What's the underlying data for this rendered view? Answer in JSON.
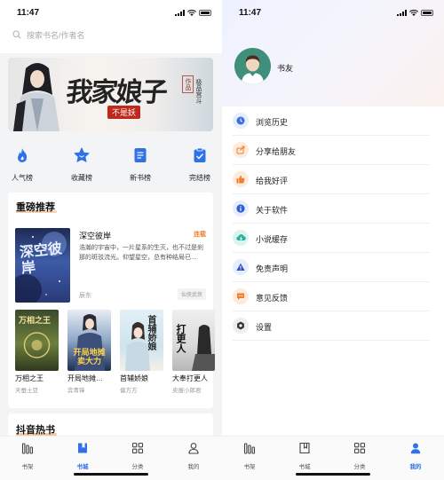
{
  "status": {
    "time_left": "11:47",
    "time_right": "11:47"
  },
  "search": {
    "placeholder": "搜索书名/作者名"
  },
  "banner": {
    "title": "我家娘子",
    "subtitle": "不是妖",
    "side_small": "极品宫斗",
    "side_tag": "作品"
  },
  "quick_nav": [
    {
      "label": "人气榜",
      "icon": "flame-icon",
      "color": "#2f72e8"
    },
    {
      "label": "收藏榜",
      "icon": "star-icon",
      "color": "#2f72e8"
    },
    {
      "label": "新书榜",
      "icon": "new-book-icon",
      "color": "#2f72e8"
    },
    {
      "label": "完结榜",
      "icon": "clipboard-check-icon",
      "color": "#2f72e8"
    }
  ],
  "recommend": {
    "title": "重磅推荐",
    "featured": {
      "title": "深空彼岸",
      "status": "连载",
      "desc": "浩瀚的宇宙中，一片星系的生灭，也不过是刹那的斑驳流光。仰望星空，总有种结局已…",
      "author": "辰东",
      "tag": "仙侠武侠",
      "cover_text": "深空彼岸"
    },
    "books": [
      {
        "name": "万相之王",
        "author": "天蚕土豆",
        "cover_text": "万相之王"
      },
      {
        "name": "开局地摊…",
        "author": "弈青锋",
        "cover_text": "开局地摊卖大力"
      },
      {
        "name": "首辅娇娘",
        "author": "偏方方",
        "cover_text": "首辅娇娘"
      },
      {
        "name": "大奉打更人",
        "author": "卖报小郎君",
        "cover_text": "打更人"
      }
    ]
  },
  "section2": {
    "title": "抖音热书"
  },
  "tabbar": [
    {
      "label": "书架",
      "icon": "bookshelf-icon"
    },
    {
      "label": "书城",
      "icon": "bookstore-icon"
    },
    {
      "label": "分类",
      "icon": "grid-icon"
    },
    {
      "label": "我的",
      "icon": "user-icon"
    }
  ],
  "accent": "#2f72e8",
  "profile": {
    "name": "书友"
  },
  "menu": [
    {
      "label": "浏览历史",
      "icon": "clock-icon",
      "color": "#3b6fe0",
      "bg": "#e6edfc"
    },
    {
      "label": "分享给朋友",
      "icon": "share-icon",
      "color": "#f0802d",
      "bg": "#fdebdc"
    },
    {
      "label": "给我好评",
      "icon": "thumbs-up-icon",
      "color": "#f0802d",
      "bg": "#fdebdc"
    },
    {
      "label": "关于软件",
      "icon": "info-icon",
      "color": "#2f5fd8",
      "bg": "#e6edfc"
    },
    {
      "label": "小说缓存",
      "icon": "cloud-download-icon",
      "color": "#25b59a",
      "bg": "#dcf4ee"
    },
    {
      "label": "免责声明",
      "icon": "warning-icon",
      "color": "#3050c8",
      "bg": "#e6edfc"
    },
    {
      "label": "意见反馈",
      "icon": "message-icon",
      "color": "#f0802d",
      "bg": "#fdebdc"
    },
    {
      "label": "设置",
      "icon": "settings-icon",
      "color": "#333333",
      "bg": "#eeeeee"
    }
  ]
}
